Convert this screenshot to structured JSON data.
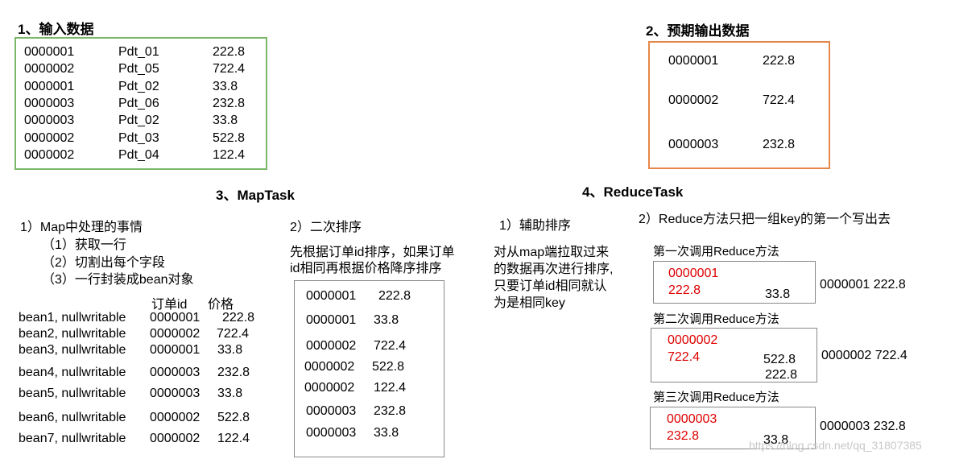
{
  "colors": {
    "input_box": "#7ab868",
    "output_box": "#e5874a",
    "gray_box": "#888888",
    "reduce_highlight": "#dd0000"
  },
  "input": {
    "title": "1、输入数据",
    "rows": [
      [
        "0000001",
        "Pdt_01",
        "222.8"
      ],
      [
        "0000002",
        "Pdt_05",
        "722.4"
      ],
      [
        "0000001",
        "Pdt_02",
        "33.8"
      ],
      [
        "0000003",
        "Pdt_06",
        "232.8"
      ],
      [
        "0000003",
        "Pdt_02",
        "33.8"
      ],
      [
        "0000002",
        "Pdt_03",
        "522.8"
      ],
      [
        "0000002",
        "Pdt_04",
        "122.4"
      ]
    ]
  },
  "output": {
    "title": "2、预期输出数据",
    "rows": [
      [
        "0000001",
        "222.8"
      ],
      [
        "0000002",
        "722.4"
      ],
      [
        "0000003",
        "232.8"
      ]
    ]
  },
  "maptask": {
    "title": "3、MapTask",
    "step1": {
      "heading": "1）Map中处理的事情",
      "items": [
        "（1）获取一行",
        "（2）切割出每个字段",
        "（3）一行封装成bean对象"
      ],
      "col_order_id": "订单id",
      "col_price": "价格",
      "beans": [
        [
          "bean1, nullwritable",
          "0000001",
          "222.8"
        ],
        [
          "bean2, nullwritable",
          "0000002",
          "722.4"
        ],
        [
          "bean3, nullwritable",
          "0000001",
          "33.8"
        ],
        [
          "bean4, nullwritable",
          "0000003",
          "232.8"
        ],
        [
          "bean5, nullwritable",
          "0000003",
          "33.8"
        ],
        [
          "bean6, nullwritable",
          "0000002",
          "522.8"
        ],
        [
          "bean7, nullwritable",
          "0000002",
          "122.4"
        ]
      ]
    },
    "step2": {
      "heading": "2）二次排序",
      "desc_line1": "先根据订单id排序，如果订单",
      "desc_line2": "id相同再根据价格降序排序",
      "sorted": [
        [
          "0000001",
          "222.8"
        ],
        [
          "0000001",
          "33.8"
        ],
        [
          "0000002",
          "722.4"
        ],
        [
          "0000002",
          "522.8"
        ],
        [
          "0000002",
          "122.4"
        ],
        [
          "0000003",
          "232.8"
        ],
        [
          "0000003",
          "33.8"
        ]
      ]
    }
  },
  "reducetask": {
    "title": "4、ReduceTask",
    "step1": {
      "heading": "1）辅助排序",
      "desc": [
        "对从map端拉取过来",
        "的数据再次进行排序,",
        "只要订单id相同就认",
        "为是相同key"
      ]
    },
    "step2": {
      "heading": "2）Reduce方法只把一组key的第一个写出去",
      "calls": [
        {
          "label": "第一次调用Reduce方法",
          "id": "0000001",
          "first": "222.8",
          "others": [
            "33.8"
          ],
          "result": "0000001  222.8"
        },
        {
          "label": "第二次调用Reduce方法",
          "id": "0000002",
          "first": "722.4",
          "others": [
            "522.8",
            "222.8"
          ],
          "result": "0000002  722.4"
        },
        {
          "label": "第三次调用Reduce方法",
          "id": "0000003",
          "first": "232.8",
          "others": [
            "33.8"
          ],
          "result": "0000003  232.8"
        }
      ]
    }
  },
  "watermark": "https://blog.csdn.net/qq_31807385"
}
